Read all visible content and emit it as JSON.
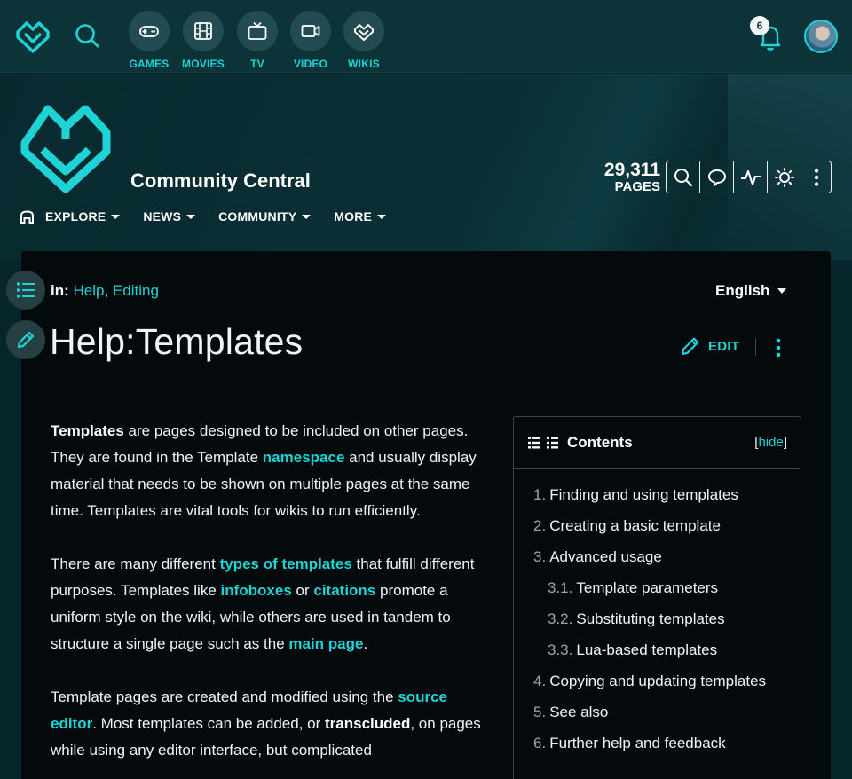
{
  "global_nav": {
    "items": [
      {
        "label": "GAMES",
        "icon": "gamepad-icon"
      },
      {
        "label": "MOVIES",
        "icon": "film-icon"
      },
      {
        "label": "TV",
        "icon": "tv-icon"
      },
      {
        "label": "VIDEO",
        "icon": "video-icon"
      },
      {
        "label": "WIKIS",
        "icon": "fandom-heart-icon"
      }
    ],
    "notification_count": "6"
  },
  "header": {
    "wiki_name": "Community Central",
    "page_count": "29,311",
    "page_count_label": "PAGES",
    "nav": [
      "EXPLORE",
      "NEWS",
      "COMMUNITY",
      "MORE"
    ]
  },
  "page": {
    "categories_prefix": "in:",
    "categories": [
      "Help",
      "Editing"
    ],
    "language": "English",
    "title": "Help:Templates",
    "edit_label": "EDIT"
  },
  "article": {
    "p1": {
      "b1": "Templates",
      "t1": " are pages designed to be included on other pages. They are found in the Template ",
      "a1": "namespace",
      "t2": " and usually display material that needs to be shown on multiple pages at the same time. Templates are vital tools for wikis to run efficiently."
    },
    "p2": {
      "t1": "There are many different ",
      "a1": "types of templates",
      "t2": " that fulfill different purposes. Templates like ",
      "a2": "infoboxes",
      "t3": " or ",
      "a3": "citations",
      "t4": " promote a uniform style on the wiki, while others are used in tandem to structure a single page such as the ",
      "a4": "main page",
      "t5": "."
    },
    "p3": {
      "t1": "Template pages are created and modified using the ",
      "a1": "source editor",
      "t2": ". Most templates can be added, or ",
      "b1": "transcluded",
      "t3": ", on pages while using any editor interface, but complicated"
    }
  },
  "toc": {
    "title": "Contents",
    "hide_open": "[",
    "hide_label": "hide",
    "hide_close": "]",
    "items": [
      {
        "num": "1.",
        "label": "Finding and using templates"
      },
      {
        "num": "2.",
        "label": "Creating a basic template"
      },
      {
        "num": "3.",
        "label": "Advanced usage"
      },
      {
        "num": "3.1.",
        "label": "Template parameters"
      },
      {
        "num": "3.2.",
        "label": "Substituting templates"
      },
      {
        "num": "3.3.",
        "label": "Lua-based templates"
      },
      {
        "num": "4.",
        "label": "Copying and updating templates"
      },
      {
        "num": "5.",
        "label": "See also"
      },
      {
        "num": "6.",
        "label": "Further help and feedback"
      }
    ]
  },
  "colors": {
    "accent": "#1ed2d6",
    "background": "#07262b",
    "content_background": "#040a0b"
  }
}
